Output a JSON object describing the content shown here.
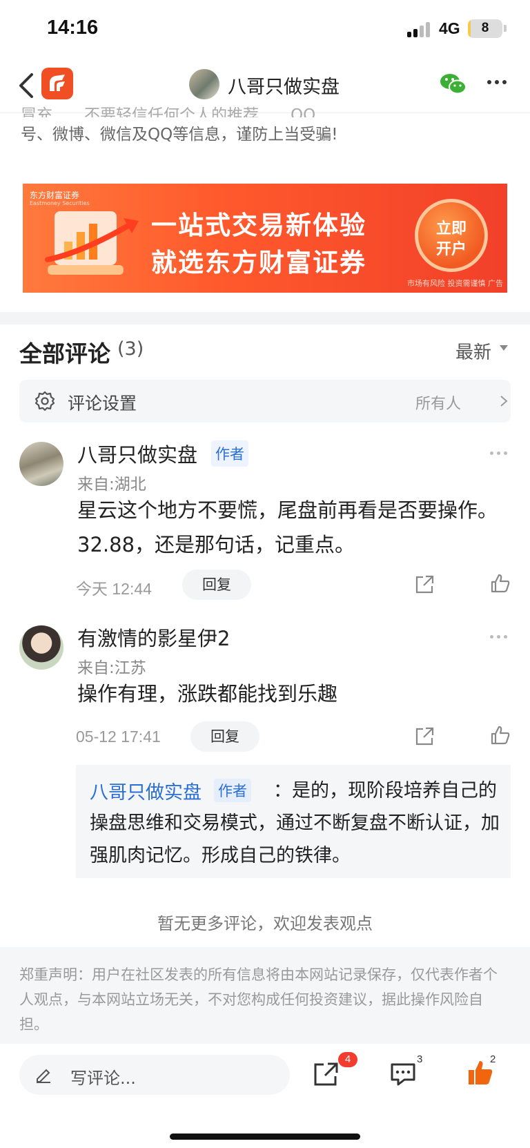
{
  "status_bar": {
    "time": "14:16",
    "network": "4G",
    "battery": "8",
    "battery_level": 0.08
  },
  "nav": {
    "title": "八哥只做实盘",
    "app_icon": "eastmoney-logo-icon"
  },
  "warning": {
    "cut_line": "冒充……不要轻信任何个人的推荐……QQ……",
    "text": "号、微博、微信及QQ等信息，谨防上当受骗!"
  },
  "banner": {
    "brand": "东方财富证券",
    "brand_en": "Eastmoney Securities",
    "line1": "一站式交易新体验",
    "line2": "就选东方财富证券",
    "cta_line1": "立即",
    "cta_line2": "开户",
    "risk": "市场有风险 投资需谨慎 广告"
  },
  "comments_header": {
    "title": "全部评论",
    "count": "(3)",
    "sort": "最新"
  },
  "comment_settings": {
    "label": "评论设置",
    "value": "所有人"
  },
  "comments": [
    {
      "name": "八哥只做实盘",
      "tag": "作者",
      "location": "来自:湖北",
      "text": "星云这个地方不要慌，尾盘前再看是否要操作。32.88，还是那句话，记重点。",
      "time": "今天 12:44",
      "reply_label": "回复"
    },
    {
      "name": "有激情的影星伊2",
      "location": "来自:江苏",
      "text": "操作有理，涨跌都能找到乐趣",
      "time": "05-12 17:41",
      "reply_label": "回复",
      "sub_reply": {
        "name": "八哥只做实盘",
        "tag": "作者",
        "text": "：是的，现阶段培养自己的操盘思维和交易模式，通过不断复盘不断认证，加强肌肉记忆。形成自己的铁律。"
      }
    }
  ],
  "no_more": "暂无更多评论，欢迎发表观点",
  "disclaimer": "郑重声明：用户在社区发表的所有信息将由本网站记录保存，仅代表作者个人观点，与本网站立场无关，不对您构成任何投资建议，据此操作风险自担。",
  "bottom_bar": {
    "compose_placeholder": "写评论...",
    "share_badge": "4",
    "comment_count": "3",
    "like_count": "2"
  },
  "colors": {
    "accent": "#f04e23",
    "link": "#2a6fd6",
    "like": "#f0650e"
  }
}
